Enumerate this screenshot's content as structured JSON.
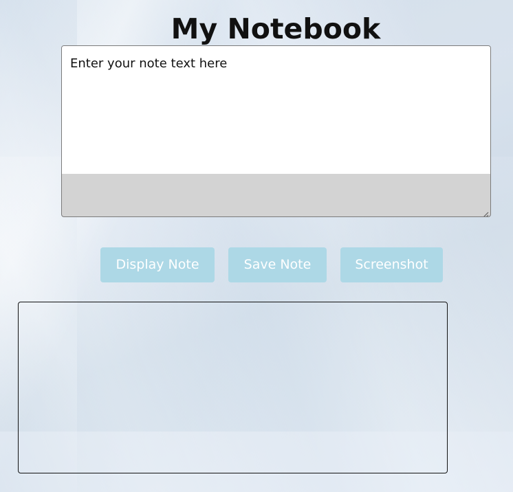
{
  "page": {
    "title": "My Notebook"
  },
  "editor": {
    "placeholder": "Enter your note text here",
    "value": ""
  },
  "buttons": {
    "display_label": "Display Note",
    "save_label": "Save Note",
    "screenshot_label": "Screenshot"
  },
  "output": {
    "content": ""
  },
  "colors": {
    "button_bg": "#add8e6",
    "button_text": "#ffffff",
    "editor_footer": "#d3d3d3"
  },
  "icons": {
    "resize": "resize-grip-icon"
  }
}
